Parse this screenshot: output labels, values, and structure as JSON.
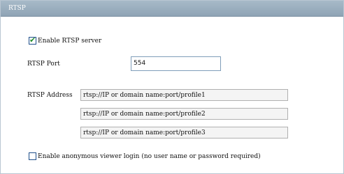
{
  "panel": {
    "title": "RTSP"
  },
  "rtsp": {
    "enable_label": "Enable RTSP server",
    "enable_checked": true,
    "port_label": "RTSP Port",
    "port_value": "554",
    "address_label": "RTSP Address",
    "addresses": [
      "rtsp://IP or domain name:port/profile1",
      "rtsp://IP or domain name:port/profile2",
      "rtsp://IP or domain name:port/profile3"
    ],
    "anonymous_label": "Enable anonymous viewer login (no user name or password required)",
    "anonymous_checked": false
  },
  "colors": {
    "title_bar": "#99adbd",
    "check_mark": "#1f8c2a"
  },
  "icons": {
    "checkmark": "check-icon"
  }
}
